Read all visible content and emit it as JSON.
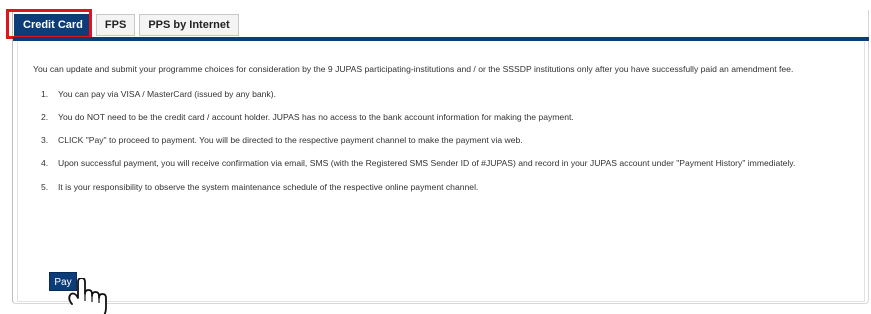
{
  "tabs": [
    {
      "label": "Credit Card",
      "active": true
    },
    {
      "label": "FPS",
      "active": false
    },
    {
      "label": "PPS by Internet",
      "active": false
    }
  ],
  "intro": "You can update and submit your programme choices for consideration by the 9 JUPAS participating-institutions and / or the SSSDP institutions only after you have successfully paid an amendment fee.",
  "steps": [
    {
      "num": "1.",
      "text": "You can pay via VISA / MasterCard (issued by any bank)."
    },
    {
      "num": "2.",
      "text": "You do NOT need to be the credit card / account holder. JUPAS has no access to the bank account information for making the payment."
    },
    {
      "num": "3.",
      "text": "CLICK \"Pay\" to proceed to payment. You will be directed to the respective payment channel to make the payment via web."
    },
    {
      "num": "4.",
      "text": "Upon successful payment, you will receive confirmation via email, SMS (with the Registered SMS Sender ID of #JUPAS) and record in your JUPAS account under \"Payment History\" immediately."
    },
    {
      "num": "5.",
      "text": "It is your responsibility to observe the system maintenance schedule of the respective online payment channel."
    }
  ],
  "pay_button": {
    "label": "Pay"
  },
  "icons": {
    "pointer": "hand-pointer-icon"
  },
  "colors": {
    "primary": "#0d3d78",
    "highlight": "#e0141b"
  }
}
